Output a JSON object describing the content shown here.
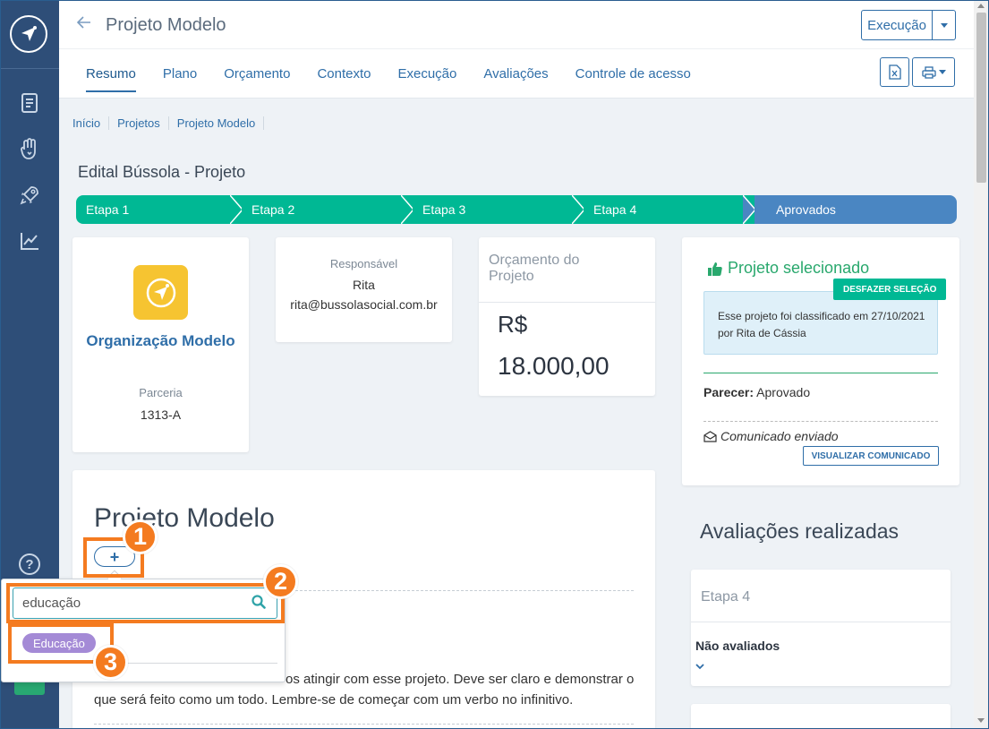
{
  "header": {
    "title": "Projeto Modelo",
    "exec_label": "Execução"
  },
  "tabs": [
    {
      "label": "Resumo"
    },
    {
      "label": "Plano"
    },
    {
      "label": "Orçamento"
    },
    {
      "label": "Contexto"
    },
    {
      "label": "Execução"
    },
    {
      "label": "Avaliações"
    },
    {
      "label": "Controle de acesso"
    }
  ],
  "breadcrumb": [
    "Início",
    "Projetos",
    "Projeto Modelo"
  ],
  "edital_title": "Edital Bússola - Projeto",
  "stepper": [
    "Etapa 1",
    "Etapa 2",
    "Etapa 3",
    "Etapa 4",
    "Aprovados"
  ],
  "org": {
    "name": "Organização Modelo",
    "type_label": "Parceria",
    "code": "1313-A"
  },
  "responsavel": {
    "label": "Responsável",
    "name": "Rita",
    "email": "rita@bussolasocial.com.br"
  },
  "budget": {
    "label": "Orçamento do Projeto",
    "currency": "R$",
    "value": "18.000,00"
  },
  "selection": {
    "title": "Projeto selecionado",
    "undo_label": "DESFAZER SELEÇÃO",
    "info": "Esse projeto foi classificado em 27/10/2021 por Rita de Cássia",
    "parecer_label": "Parecer:",
    "parecer_value": "Aprovado",
    "comunicado": "Comunicado enviado",
    "view_label": "VISUALIZAR COMUNICADO"
  },
  "project": {
    "title": "Projeto Modelo",
    "plus_label": "+",
    "description_fragment": "os atingir com esse projeto. Deve ser claro e demonstrar o",
    "description_line2": "que será feito como um todo. Lembre-se de começar com um verbo no infinitivo."
  },
  "search": {
    "value": "educação",
    "tag": "Educação"
  },
  "avaliacoes": {
    "title": "Avaliações realizadas",
    "etapa": "Etapa 4",
    "status": "Não avaliados"
  },
  "annotations": [
    "1",
    "2",
    "3"
  ],
  "colors": {
    "sidebar": "#2e4e78",
    "primary": "#2f6ea8",
    "step_green": "#00b894",
    "step_blue": "#4a86c2",
    "success": "#29a86d",
    "tag_purple": "#a48ad6",
    "highlight": "#f47b20"
  }
}
